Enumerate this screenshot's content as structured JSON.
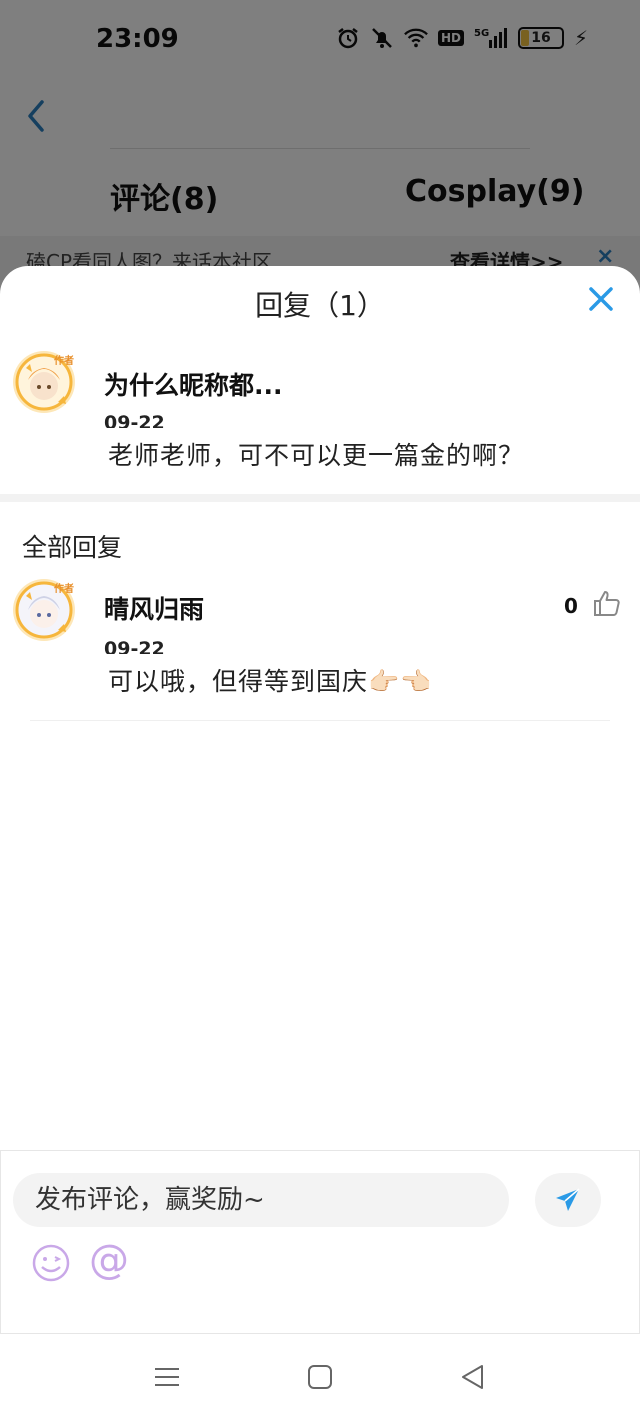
{
  "status_bar": {
    "time": "23:09",
    "network": "5G",
    "hd": "HD",
    "battery": "16"
  },
  "header": {
    "tabs": [
      {
        "label": "评论(8)"
      },
      {
        "label": "Cosplay(9)"
      }
    ]
  },
  "banner": {
    "text": "磕CP看同人图？来话本社区",
    "link": "查看详情>>",
    "close": "×"
  },
  "sheet": {
    "title": "回复（1）"
  },
  "parent_comment": {
    "name": "为什么昵称都...",
    "badge": "作者",
    "date": "09-22",
    "text": "老师老师，可不可以更一篇金的啊？"
  },
  "replies_header": "全部回复",
  "replies": [
    {
      "name": "晴风归雨",
      "badge": "作者",
      "date": "09-22",
      "text": "可以哦，但得等到国庆",
      "emoji": "👉🏻👈🏻",
      "likes": "0"
    }
  ],
  "composer": {
    "placeholder": "发布评论，赢奖励~",
    "at": "@"
  },
  "colors": {
    "accent": "#2a9ae6",
    "avatar_ring": "#f6b63c",
    "emoji_icon": "#c9a8e8"
  }
}
